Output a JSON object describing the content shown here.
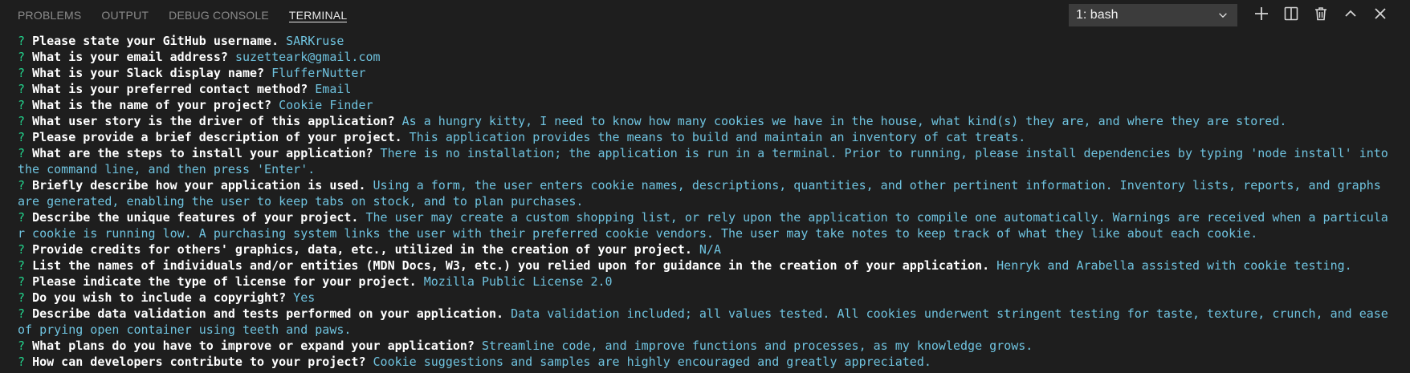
{
  "tabs": [
    {
      "label": "PROBLEMS",
      "active": false
    },
    {
      "label": "OUTPUT",
      "active": false
    },
    {
      "label": "DEBUG CONSOLE",
      "active": false
    },
    {
      "label": "TERMINAL",
      "active": true
    }
  ],
  "shell_selector": {
    "value": "1: bash"
  },
  "actions": [
    {
      "name": "new-terminal-button",
      "icon": "plus-icon"
    },
    {
      "name": "split-terminal-button",
      "icon": "split-icon"
    },
    {
      "name": "kill-terminal-button",
      "icon": "trash-icon"
    },
    {
      "name": "maximize-panel-button",
      "icon": "chevron-up-icon"
    },
    {
      "name": "close-panel-button",
      "icon": "close-icon"
    }
  ],
  "colors": {
    "background": "#1e1e1e",
    "prompt_mark": "#23d18b",
    "question": "#ffffff",
    "answer": "#6fc3df"
  },
  "terminal": {
    "prompt_mark": "?",
    "lines": [
      {
        "question": "Please state your GitHub username.",
        "answer": "SARKruse"
      },
      {
        "question": "What is your email address?",
        "answer": "suzetteark@gmail.com"
      },
      {
        "question": "What is your Slack display name?",
        "answer": "FlufferNutter"
      },
      {
        "question": "What is your preferred contact method?",
        "answer": "Email"
      },
      {
        "question": "What is the name of your project?",
        "answer": "Cookie Finder"
      },
      {
        "question": "What user story is the driver of this application?",
        "answer": "As a hungry kitty, I need to know how many cookies we have in the house, what kind(s) they are, and where they are stored."
      },
      {
        "question": "Please provide a brief description of your project.",
        "answer": "This application provides the means to build and maintain an inventory of cat treats."
      },
      {
        "question": "What are the steps to install your application?",
        "answer": "There is no installation; the application is run in a terminal. Prior to running, please install dependencies by typing 'node install' into the command line, and then press 'Enter'."
      },
      {
        "question": "Briefly describe how your application is used.",
        "answer": "Using a form, the user enters cookie names, descriptions, quantities, and other pertinent information. Inventory lists, reports, and graphs are generated, enabling the user to keep tabs on stock, and to plan purchases."
      },
      {
        "question": "Describe the unique features of your project.",
        "answer": "The user may create a custom shopping list, or rely upon the application to compile one automatically. Warnings are received when a particular cookie is running low. A purchasing system links the user with their preferred cookie vendors. The user may take notes to keep track of what they like about each cookie."
      },
      {
        "question": "Provide credits for others' graphics, data, etc., utilized in the creation of your project.",
        "answer": "N/A"
      },
      {
        "question": "List the names of individuals and/or entities (MDN Docs, W3, etc.) you relied upon for guidance in the creation of your application.",
        "answer": "Henryk and Arabella assisted with cookie testing."
      },
      {
        "question": "Please indicate the type of license for your project.",
        "answer": "Mozilla Public License 2.0"
      },
      {
        "question": "Do you wish to include a copyright?",
        "answer": "Yes"
      },
      {
        "question": "Describe data validation and tests performed on your application.",
        "answer": "Data validation included; all values tested. All cookies underwent stringent testing for taste, texture, crunch, and ease of prying open container using teeth and paws."
      },
      {
        "question": "What plans do you have to improve or expand your application?",
        "answer": "Streamline code, and improve functions and processes, as my knowledge grows."
      },
      {
        "question": "How can developers contribute to your project?",
        "answer": "Cookie suggestions and samples are highly encouraged and greatly appreciated."
      }
    ]
  }
}
